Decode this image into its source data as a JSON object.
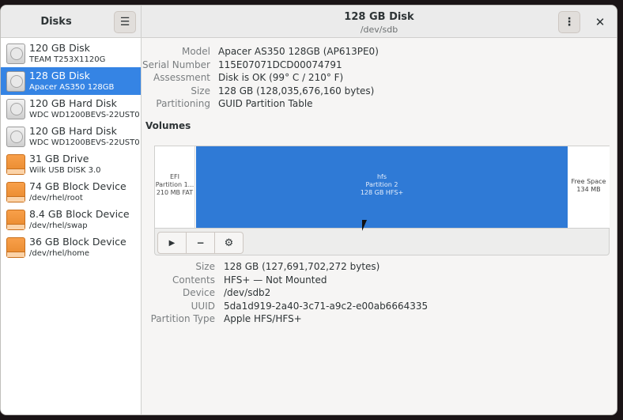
{
  "sidebar": {
    "title": "Disks",
    "menu_icon": "hamburger-icon",
    "disks": [
      {
        "name": "120 GB Disk",
        "sub": "TEAM T253X1120G",
        "icon": "hdd"
      },
      {
        "name": "128 GB Disk",
        "sub": "Apacer AS350 128GB",
        "icon": "hdd"
      },
      {
        "name": "120 GB Hard Disk",
        "sub": "WDC WD1200BEVS-22UST0",
        "icon": "hdd"
      },
      {
        "name": "120 GB Hard Disk",
        "sub": "WDC WD1200BEVS-22UST0",
        "icon": "hdd"
      },
      {
        "name": "31 GB Drive",
        "sub": "Wilk USB DISK 3.0",
        "icon": "orange"
      },
      {
        "name": "74 GB Block Device",
        "sub": "/dev/rhel/root",
        "icon": "orange"
      },
      {
        "name": "8.4 GB Block Device",
        "sub": "/dev/rhel/swap",
        "icon": "orange"
      },
      {
        "name": "36 GB Block Device",
        "sub": "/dev/rhel/home",
        "icon": "orange"
      }
    ]
  },
  "header": {
    "title": "128 GB Disk",
    "subtitle": "/dev/sdb",
    "menu_glyph": "⋮",
    "close_glyph": "✕"
  },
  "disk_info": [
    {
      "label": "Model",
      "value": "Apacer AS350 128GB (AP613PE0)"
    },
    {
      "label": "Serial Number",
      "value": "115E07071DCD00074791"
    },
    {
      "label": "Assessment",
      "value": "Disk is OK (99° C / 210° F)"
    },
    {
      "label": "Size",
      "value": "128 GB (128,035,676,160 bytes)"
    },
    {
      "label": "Partitioning",
      "value": "GUID Partition Table"
    }
  ],
  "volumes": {
    "heading": "Volumes",
    "partitions": [
      {
        "line1": "EFI",
        "line2": "Partition 1...",
        "line3": "210 MB FAT"
      },
      {
        "line1": "hfs",
        "line2": "Partition 2",
        "line3": "128 GB HFS+"
      },
      {
        "line1": "Free Space",
        "line2": "134 MB",
        "line3": ""
      }
    ],
    "toolbar": {
      "play": "▶",
      "remove": "−",
      "settings": "⚙"
    }
  },
  "partition_details": [
    {
      "label": "Size",
      "value": "128 GB (127,691,702,272 bytes)"
    },
    {
      "label": "Contents",
      "value": "HFS+ — Not Mounted"
    },
    {
      "label": "Device",
      "value": "/dev/sdb2"
    },
    {
      "label": "UUID",
      "value": "5da1d919-2a40-3c71-a9c2-e00ab6664335"
    },
    {
      "label": "Partition Type",
      "value": "Apple HFS/HFS+"
    }
  ],
  "colors": {
    "accent": "#3584e4",
    "partition_fill": "#2f7ad6",
    "drive_orange": "#f39a3e"
  }
}
